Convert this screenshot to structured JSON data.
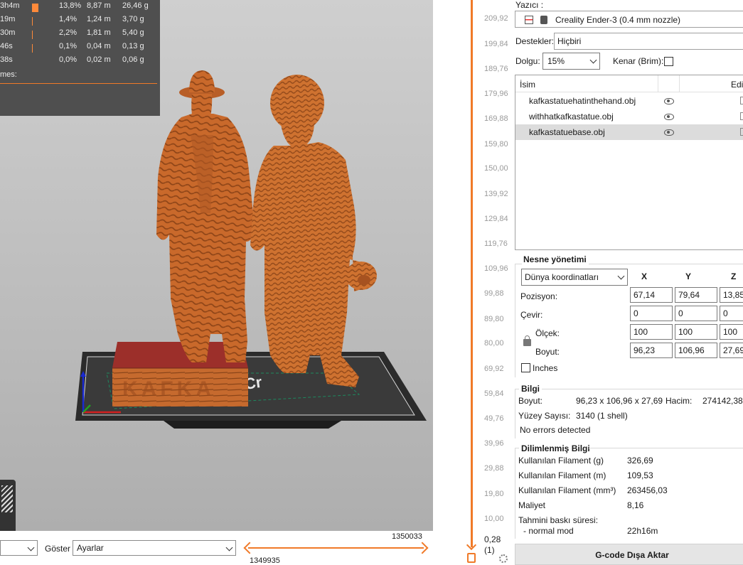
{
  "stats": {
    "rows": [
      {
        "time": "3h4m",
        "pct": "13,8%",
        "length": "8,87 m",
        "weight": "26,46 g",
        "bar_fraction": 0.138
      },
      {
        "time": "19m",
        "pct": "1,4%",
        "length": "1,24 m",
        "weight": "3,70 g",
        "bar_fraction": 0.014
      },
      {
        "time": "30m",
        "pct": "2,2%",
        "length": "1,81 m",
        "weight": "5,40 g",
        "bar_fraction": 0.022
      },
      {
        "time": "46s",
        "pct": "0,1%",
        "length": "0,04 m",
        "weight": "0,13 g",
        "bar_fraction": 0.001
      },
      {
        "time": "38s",
        "pct": "0,0%",
        "length": "0,02 m",
        "weight": "0,06 g",
        "bar_fraction": 0.0
      }
    ],
    "footer": "mes:",
    "accent": "#f07a28"
  },
  "bottom": {
    "goster_label": "Göster",
    "goster_value": "Ayarlar",
    "slider_max": "1350033",
    "slider_min": "1349935"
  },
  "layer_slider": {
    "ticks": [
      "209,92",
      "199,84",
      "189,76",
      "179,96",
      "169,88",
      "159,80",
      "150,00",
      "139,92",
      "129,84",
      "119,76",
      "109,96",
      "99,88",
      "89,80",
      "80,00",
      "69,92",
      "59,84",
      "49,76",
      "39,96",
      "29,88",
      "19,80",
      "10,00"
    ],
    "bottom_value": "0,28",
    "bottom_index": "(1)"
  },
  "sidebar": {
    "printer_label": "Yazıcı :",
    "printer_name": "Creality Ender-3 (0.4 mm nozzle)",
    "supports_label": "Destekler:",
    "supports_value": "Hiçbiri",
    "infill_label": "Dolgu:",
    "infill_value": "15%",
    "brim_label": "Kenar (Brim):",
    "objects": {
      "col_name": "İsim",
      "col_edit": "Edi",
      "items": [
        {
          "name": "kafkastatuehatinthehand.obj",
          "selected": false
        },
        {
          "name": "withhatkafkastatue.obj",
          "selected": false
        },
        {
          "name": "kafkastatuebase.obj",
          "selected": true
        }
      ]
    },
    "manip": {
      "title": "Nesne yönetimi",
      "coord_system": "Dünya koordinatları",
      "axes": [
        "X",
        "Y",
        "Z"
      ],
      "position_label": "Pozisyon:",
      "position": [
        "67,14",
        "79,64",
        "13,85"
      ],
      "rotate_label": "Çevir:",
      "rotate": [
        "0",
        "0",
        "0"
      ],
      "scale_label": "Ölçek:",
      "scale": [
        "100",
        "100",
        "100"
      ],
      "size_label": "Boyut:",
      "size": [
        "96,23",
        "106,96",
        "27,69"
      ],
      "inches_label": "Inches"
    },
    "info": {
      "title": "Bilgi",
      "size_label": "Boyut:",
      "size_value": "96,23 x 106,96 x 27,69",
      "volume_label": "Hacim:",
      "volume_value": "274142,38",
      "facets_label": "Yüzey Sayısı:",
      "facets_value": "3140 (1 shell)",
      "errors": "No errors detected"
    },
    "sliced": {
      "title": "Dilimlenmiş Bilgi",
      "rows": [
        {
          "label": "Kullanılan Filament (g)",
          "value": "326,69"
        },
        {
          "label": "Kullanılan Filament (m)",
          "value": "109,53"
        },
        {
          "label": "Kullanılan Filament (mm³)",
          "value": "263456,03"
        },
        {
          "label": "Maliyet",
          "value": "8,16"
        }
      ],
      "print_time_label": "Tahmini baskı süresi:",
      "normal_mode_label": "- normal mod",
      "normal_mode_value": "22h16m"
    },
    "export_label": "G-code Dışa Aktar"
  },
  "colors": {
    "accent": "#f07a28",
    "model": "#c96a2c",
    "base_top": "#9c2f2a"
  }
}
